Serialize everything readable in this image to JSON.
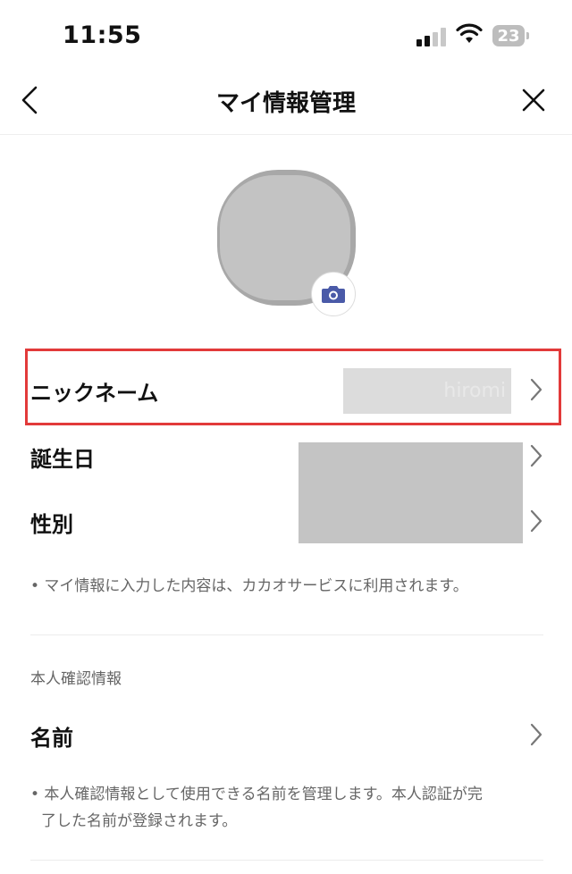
{
  "status_bar": {
    "time": "11:55",
    "battery": "23"
  },
  "nav": {
    "title": "マイ情報管理",
    "back_icon": "chevron-left-icon",
    "close_icon": "close-icon"
  },
  "profile": {
    "camera_icon": "camera-icon",
    "camera_color": "#4a5aa8"
  },
  "rows": {
    "nickname_label": "ニックネーム",
    "nickname_value": "hiromi",
    "birthday_label": "誕生日",
    "gender_label": "性別"
  },
  "notes": {
    "my_info": "• マイ情報に入力した内容は、カカオサービスに利用されます。",
    "identity_line1": "• 本人確認情報として使用できる名前を管理します。本人認証が完",
    "identity_line2": "了した名前が登録されます。"
  },
  "identity": {
    "section_title": "本人確認情報",
    "name_label": "名前"
  },
  "colors": {
    "highlight": "#e23a3a",
    "redaction": "#c4c4c4"
  }
}
